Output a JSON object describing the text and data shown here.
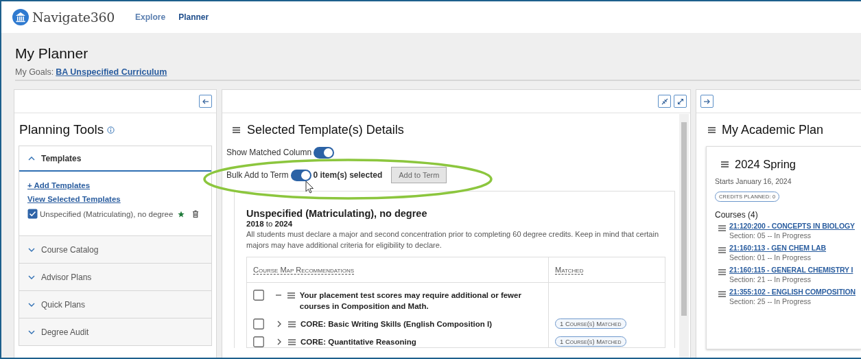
{
  "app": {
    "brand": "Navigate360",
    "nav": [
      {
        "label": "Explore",
        "selected": false
      },
      {
        "label": "Planner",
        "selected": true
      }
    ]
  },
  "page": {
    "title": "My Planner",
    "goals_label": "My Goals:",
    "goals_link": "BA Unspecified Curriculum"
  },
  "tools": {
    "title": "Planning Tools",
    "sections": [
      {
        "label": "Templates",
        "expanded": true,
        "links": [
          "+ Add Templates",
          "View Selected Templates"
        ],
        "templates": [
          {
            "name": "Unspecified (Matriculating), no degree",
            "checked": true
          }
        ]
      },
      {
        "label": "Course Catalog",
        "expanded": false
      },
      {
        "label": "Advisor Plans",
        "expanded": false
      },
      {
        "label": "Quick Plans",
        "expanded": false
      },
      {
        "label": "Degree Audit",
        "expanded": false
      }
    ]
  },
  "details": {
    "title": "Selected Template(s) Details",
    "toggles": [
      {
        "label": "Show Matched Column",
        "on": true
      },
      {
        "label": "Bulk Add to Term",
        "on": true
      }
    ],
    "selection_count": "0 item(s) selected",
    "add_button": {
      "label": "Add to Term",
      "disabled": true
    },
    "template": {
      "name": "Unspecified (Matriculating), no degree",
      "years": "**2018** to **2024**",
      "description": "All students must declare a major and second concentration prior to completing 60 degree credits. Keep in mind that certain majors may have additional criteria for eligibility to declare.",
      "columns": [
        "Course Map Recommendations",
        "Matched"
      ],
      "rows": [
        {
          "kind": "note",
          "checked": false,
          "text": "Your placement test scores may require additional or fewer courses in Composition and Math."
        },
        {
          "kind": "requirement",
          "checked": false,
          "text": "CORE: Basic Writing Skills (English Composition I)",
          "matched": "1 Course(s) Matched"
        },
        {
          "kind": "requirement",
          "checked": false,
          "text": "CORE: Quantitative Reasoning",
          "matched": "1 Course(s) Matched"
        }
      ]
    }
  },
  "plan": {
    "title": "My Academic Plan",
    "term": {
      "name": "2024 Spring",
      "starts": "Starts January 16, 2024",
      "credits": "CREDITS PLANNED: 0",
      "courses_label": "Courses (4)",
      "courses": [
        {
          "title": "21:120:200 - CONCEPTS IN BIOLOGY",
          "status": "Section: 05 -- In Progress"
        },
        {
          "title": "21:160:113 - GEN CHEM LAB",
          "status": "Section: 01 -- In Progress"
        },
        {
          "title": "21:160:115 - GENERAL CHEMISTRY I",
          "status": "Section: 21 -- In Progress"
        },
        {
          "title": "21:355:102 - ENGLISH COMPOSITION",
          "status": "Section: 25 -- In Progress"
        }
      ]
    }
  }
}
